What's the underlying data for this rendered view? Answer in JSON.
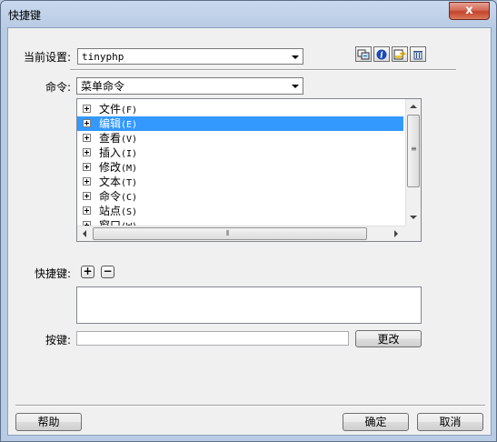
{
  "window": {
    "title": "快捷键",
    "close_label": "x"
  },
  "settings": {
    "label": "当前设置:",
    "value": "tinyphp"
  },
  "commands": {
    "label": "命令:",
    "value": "菜单命令"
  },
  "tree": {
    "items": [
      {
        "label": "文件",
        "hotkey": "(F)"
      },
      {
        "label": "编辑",
        "hotkey": "(E)",
        "selected": true
      },
      {
        "label": "查看",
        "hotkey": "(V)"
      },
      {
        "label": "插入",
        "hotkey": "(I)"
      },
      {
        "label": "修改",
        "hotkey": "(M)"
      },
      {
        "label": "文本",
        "hotkey": "(T)"
      },
      {
        "label": "命令",
        "hotkey": "(C)"
      },
      {
        "label": "站点",
        "hotkey": "(S)"
      },
      {
        "label": "窗口",
        "hotkey": "(W)"
      }
    ]
  },
  "shortcuts": {
    "label": "快捷键:",
    "add": "+",
    "remove": "−"
  },
  "keypress": {
    "label": "按键:",
    "value": "",
    "change_button": "更改"
  },
  "footer": {
    "help": "帮助",
    "ok": "确定",
    "cancel": "取消"
  },
  "toolbar": {
    "icons": [
      "duplicate-set-icon",
      "info-icon",
      "export-html-icon",
      "delete-set-icon"
    ]
  }
}
